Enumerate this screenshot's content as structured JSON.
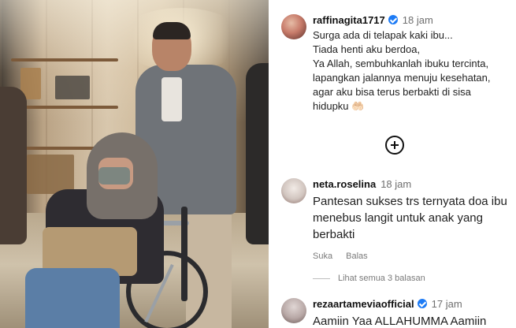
{
  "post": {
    "username": "raffinagita1717",
    "time": "18 jam",
    "caption_lines": [
      "Surga ada di telapak kaki ibu...",
      "Tiada henti aku berdoa,",
      "Ya Allah, sembuhkanlah ibuku tercinta,",
      "lapangkan jalannya menuju kesehatan,",
      "agar aku bisa terus berbakti di sisa",
      "hidupku 🤲🏻"
    ]
  },
  "comments": [
    {
      "username": "neta.roselina",
      "time": "18 jam",
      "text": "Pantesan sukses trs ternyata doa ibu menebus langit untuk anak yang berbakti",
      "like_label": "Suka",
      "reply_label": "Balas"
    },
    {
      "username": "rezaartameviaofficial",
      "time": "17 jam",
      "text": "Aamiin Yaa ALLAHUMMA Aamiin"
    }
  ],
  "view_replies": "Lihat semua 3 balasan",
  "icons": {
    "verified": "verified-icon",
    "plus": "plus-circle-icon"
  },
  "colors": {
    "verified": "#1d7bf5",
    "muted": "#6f6f6f"
  }
}
